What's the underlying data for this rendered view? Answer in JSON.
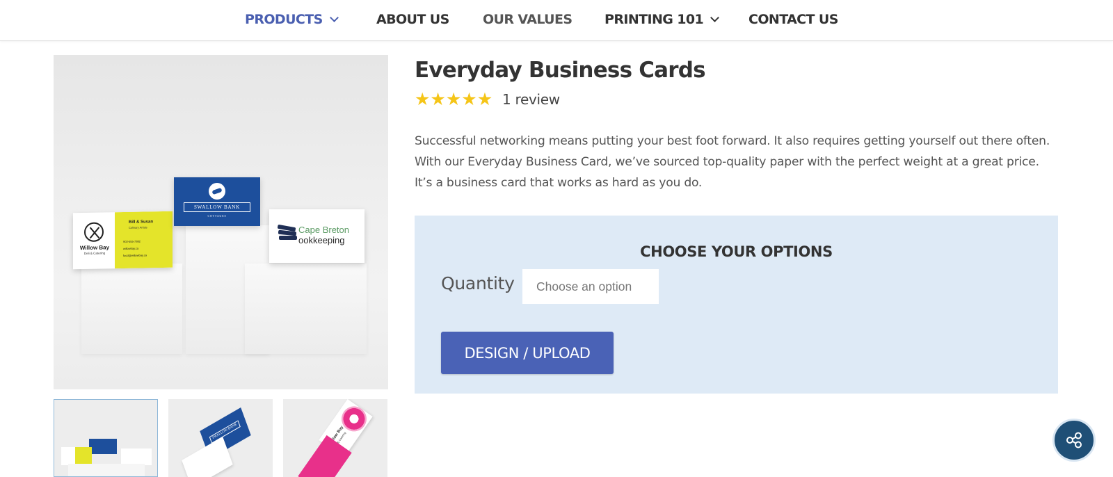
{
  "nav": {
    "items": [
      {
        "label": "PRODUCTS",
        "has_dropdown": true,
        "active": true
      },
      {
        "label": "ABOUT US",
        "has_dropdown": false
      },
      {
        "label": "OUR VALUES",
        "has_dropdown": false
      },
      {
        "label": "PRINTING 101",
        "has_dropdown": true
      },
      {
        "label": "CONTACT US",
        "has_dropdown": false
      }
    ]
  },
  "gallery": {
    "main_image": {
      "cards": {
        "willow_name": "Willow Bay",
        "willow_sub": "Deli & Catering",
        "bill_name": "Bill & Susan",
        "bill_role": "Culinary Artists",
        "phone": "902-555-7382",
        "web": "willowbay.ca",
        "email": "food@willowbay.ca",
        "swallow_name": "SWALLOW BANK",
        "swallow_sub": "COTTAGES",
        "cape_line1": "Cape Breton",
        "cape_line2": "ookkeeping"
      }
    },
    "thumbnails": [
      {
        "name": "thumbnail-1",
        "selected": true
      },
      {
        "name": "thumbnail-2",
        "selected": false
      },
      {
        "name": "thumbnail-3",
        "selected": false
      }
    ],
    "thumb_texts": {
      "swallow_name": "SWALLOW BANK",
      "willow_name": "Willow Bay",
      "willow_sub": "Deli & Catering"
    }
  },
  "product": {
    "title": "Everyday Business Cards",
    "rating": 5,
    "review_text": "1 review",
    "description": "Successful networking means putting your best foot forward. It also requires getting yourself out there often. With our Everyday Business Card, we’ve sourced top-quality paper with the perfect weight at a great price. It’s a business card that works as hard as you do."
  },
  "options": {
    "heading": "CHOOSE YOUR OPTIONS",
    "quantity_label": "Quantity",
    "quantity_value": "Choose an option",
    "design_button": "DESIGN / UPLOAD"
  },
  "colors": {
    "accent": "#4a62b6",
    "nav_active": "#4a5fb0",
    "options_bg": "#deeaf6",
    "star": "#f5c518",
    "share_bg": "#1f4f76"
  },
  "icons": {
    "nav_dropdown": "chevron-down-icon",
    "rating": "star-icon",
    "share": "share-icon"
  }
}
